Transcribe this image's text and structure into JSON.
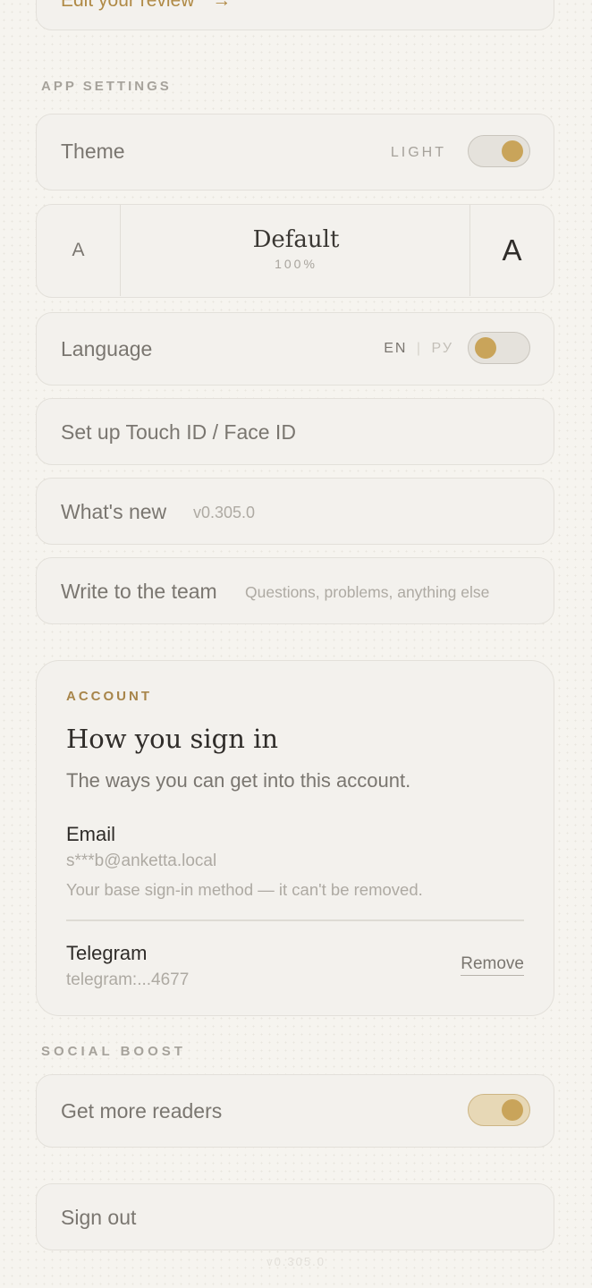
{
  "top_link": {
    "label": "Edit your review",
    "arrow": "→"
  },
  "app_settings": {
    "section_label": "APP SETTINGS",
    "theme": {
      "label": "Theme",
      "value": "LIGHT",
      "toggle_on": false
    },
    "text_size": {
      "small_glyph": "A",
      "title": "Default",
      "percent": "100%",
      "large_glyph": "A"
    },
    "language": {
      "label": "Language",
      "option_en": "EN",
      "separator": "|",
      "option_ru": "РУ",
      "toggle_on": false
    },
    "touch_id": {
      "label": "Set up Touch ID / Face ID"
    },
    "whats_new": {
      "label": "What's new",
      "version": "v0.305.0"
    },
    "write_team": {
      "label": "Write to the team",
      "hint": "Questions, problems, anything else"
    }
  },
  "account": {
    "eyebrow": "ACCOUNT",
    "title": "How you sign in",
    "subtitle": "The ways you can get into this account.",
    "email": {
      "label": "Email",
      "value": "s***b@anketta.local",
      "note": "Your base sign-in method — it can't be removed."
    },
    "telegram": {
      "label": "Telegram",
      "value": "telegram:...4677",
      "remove_label": "Remove"
    }
  },
  "social_boost": {
    "section_label": "SOCIAL BOOST",
    "get_readers": {
      "label": "Get more readers",
      "toggle_on": true
    }
  },
  "sign_out": {
    "label": "Sign out"
  },
  "footer": {
    "version": "v0.305.0"
  },
  "colors": {
    "accent": "#c9a45a",
    "eyebrow": "#a8854a",
    "background": "#f6f4ef"
  }
}
